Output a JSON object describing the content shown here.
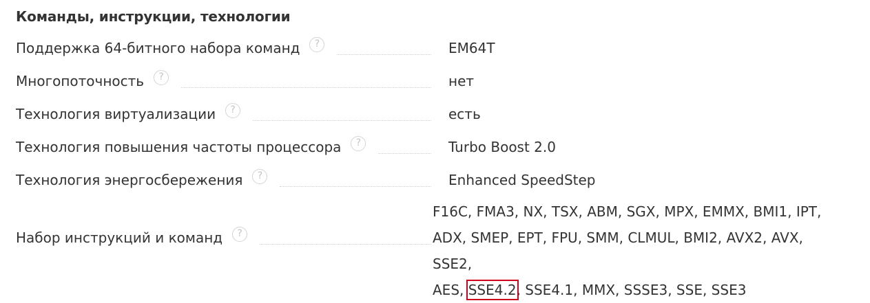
{
  "section": {
    "title": "Команды, инструкции, технологии"
  },
  "rows": [
    {
      "label": "Поддержка 64-битного набора команд",
      "value": "EM64T"
    },
    {
      "label": "Многопоточность",
      "value": "нет"
    },
    {
      "label": "Технология виртуализации",
      "value": "есть"
    },
    {
      "label": "Технология повышения частоты процессора",
      "value": "Turbo Boost 2.0"
    },
    {
      "label": "Технология энергосбережения",
      "value": "Enhanced SpeedStep"
    }
  ],
  "instructions": {
    "label": "Набор инструкций и команд",
    "line1": "F16C, FMA3, NX, TSX, ABM, SGX, MPX, EMMX, BMI1, IPT,",
    "line2": "ADX, SMEP, EPT, FPU, SMM, CLMUL, BMI2, AVX2, AVX, SSE2,",
    "line3_before": "AES, ",
    "line3_highlight": "SSE4.2",
    "line3_after": ", SSE4.1, MMX, SSSE3, SSE, SSE3"
  },
  "help_icon": {
    "icon": "question-circle-icon",
    "glyph": "?"
  },
  "colors": {
    "text": "#333333",
    "highlight_border": "#d0021b",
    "help_icon": "#c4c4c4"
  }
}
